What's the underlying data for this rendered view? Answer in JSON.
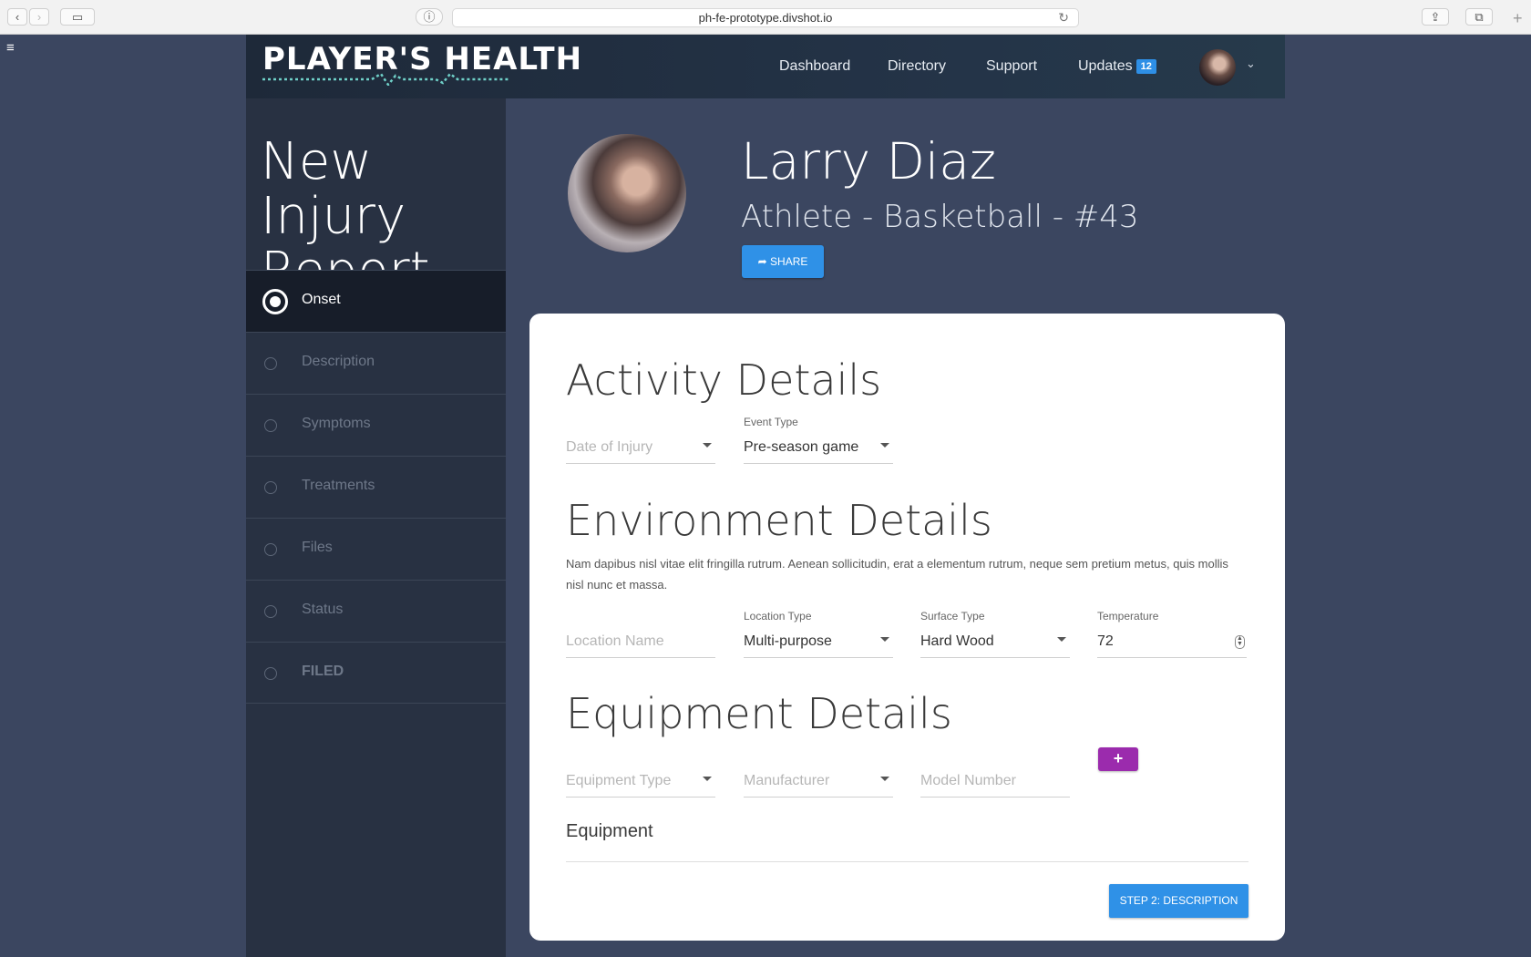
{
  "browser": {
    "url": "ph-fe-prototype.divshot.io"
  },
  "header": {
    "logo": "PLAYER'S HEALTH",
    "nav": [
      {
        "label": "Dashboard"
      },
      {
        "label": "Directory"
      },
      {
        "label": "Support"
      },
      {
        "label": "Updates",
        "badge": "12"
      }
    ]
  },
  "sidebar": {
    "title": "New Injury Report",
    "steps": [
      {
        "label": "Onset",
        "active": true
      },
      {
        "label": "Description"
      },
      {
        "label": "Symptoms"
      },
      {
        "label": "Treatments"
      },
      {
        "label": "Files"
      },
      {
        "label": "Status"
      },
      {
        "label": "FILED"
      }
    ]
  },
  "profile": {
    "name": "Larry Diaz",
    "subtitle": "Athlete - Basketball - #43",
    "share_label": "SHARE"
  },
  "activity": {
    "heading": "Activity Details",
    "date_placeholder": "Date of Injury",
    "event_label": "Event Type",
    "event_value": "Pre-season game"
  },
  "environment": {
    "heading": "Environment Details",
    "description": "Nam dapibus nisl vitae elit fringilla rutrum. Aenean sollicitudin, erat a elementum rutrum, neque sem pretium metus, quis mollis nisl nunc et massa.",
    "location_placeholder": "Location Name",
    "location_type_label": "Location Type",
    "location_type_value": "Multi-purpose",
    "surface_label": "Surface Type",
    "surface_value": "Hard Wood",
    "temperature_label": "Temperature",
    "temperature_value": "72"
  },
  "equipment": {
    "heading": "Equipment Details",
    "type_placeholder": "Equipment Type",
    "manufacturer_placeholder": "Manufacturer",
    "model_placeholder": "Model Number",
    "add_label": "+",
    "list_heading": "Equipment"
  },
  "next_label": "STEP 2: DESCRIPTION",
  "colors": {
    "primary": "#2f91e7",
    "accent_purple": "#9b2bad",
    "background": "#3b4660",
    "sidebar": "#283142"
  }
}
